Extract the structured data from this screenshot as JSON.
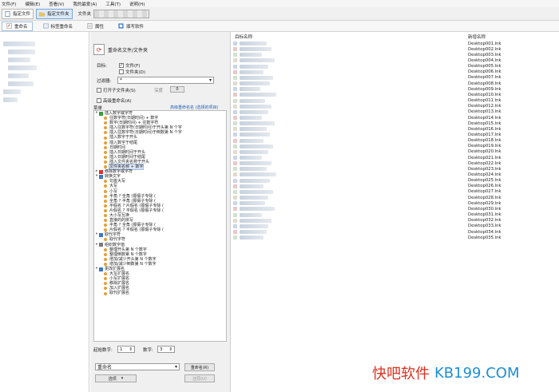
{
  "menu": [
    "文件(F)",
    "编辑(E)",
    "查看(V)",
    "我的最爱(A)",
    "工具(T)",
    "说明(H)"
  ],
  "toolbar": {
    "specify_file": "指定文件",
    "specify_folder": "指定文件夹",
    "folder_label": "文件夹"
  },
  "tabs": [
    "重命名",
    "标签重命名",
    "属性",
    "填写软件"
  ],
  "panel": {
    "title": "重命名文件/文件夹",
    "target_label": "目标:",
    "target_file": "文件(F)",
    "target_folder": "文件夹(D)",
    "filter_label": "过滤器:",
    "filter_value": "*",
    "include_subfolders": "打开子文件夹(S)",
    "depth_label": "深度",
    "depth_value": "0",
    "advanced": "高级重命名(A)",
    "menu_label": "菜单",
    "advanced_link": "高级重命名名 (选择的项目)",
    "start_label": "起始数字:",
    "start_value": "1",
    "digits_label": "数字:",
    "digits_value": "3",
    "action_select": "重命名",
    "rename_button": "重命名(R)",
    "options_button": "选项",
    "undo_button": "还原(U)"
  },
  "tree": [
    {
      "type": "cat",
      "text": "插入数字或字符",
      "expanded": true,
      "icon": "green"
    },
    {
      "type": "item",
      "text": "往数字符(日期时间) + 数字"
    },
    {
      "type": "item",
      "text": "数字(日期时间) + 往数字符"
    },
    {
      "type": "item",
      "text": "插入往数字符(日期时间)于开头第 N 个字"
    },
    {
      "type": "item",
      "text": "插入往数字符(日期时间)于倒数第 N 个字"
    },
    {
      "type": "item",
      "text": "插入数字于开头"
    },
    {
      "type": "item",
      "text": "插入数字于结尾"
    },
    {
      "type": "item",
      "text": "日期时间"
    },
    {
      "type": "item",
      "text": "插入日期时间于开头"
    },
    {
      "type": "item",
      "text": "插入日期时间于结尾"
    },
    {
      "type": "item",
      "text": "插入文件夹名称于开头"
    },
    {
      "type": "item",
      "text": "文件夹名称 + 数字",
      "selected": true
    },
    {
      "type": "cat",
      "text": "移除数字或字符",
      "expanded": false,
      "icon": "red"
    },
    {
      "type": "cat",
      "text": "转换文字",
      "expanded": true,
      "icon": "blue"
    },
    {
      "type": "item",
      "text": "句首大写"
    },
    {
      "type": "item",
      "text": "大写"
    },
    {
      "type": "item",
      "text": "小写"
    },
    {
      "type": "item",
      "text": "半角 ? 全角 (振假子专除 ( "
    },
    {
      "type": "item",
      "text": "全角 ? 半角 (振假子专除 ( "
    },
    {
      "type": "item",
      "text": "平假名 ? 片假名 (振假子专除 ( "
    },
    {
      "type": "item",
      "text": "片假名 ? 平假名 (振假子专除 ( "
    },
    {
      "type": "item",
      "text": "大小写互换"
    },
    {
      "type": "item",
      "text": "直接的的拼写"
    },
    {
      "type": "item",
      "text": "半角 ? 全角 (振假子专除 ( "
    },
    {
      "type": "item",
      "text": "片假名 ? 平假名 (振假子专除 ( "
    },
    {
      "type": "cat",
      "text": "取代字符",
      "expanded": true,
      "icon": "blue"
    },
    {
      "type": "item",
      "text": "取代字符"
    },
    {
      "type": "cat",
      "text": "组织数字值",
      "expanded": true,
      "icon": "gray"
    },
    {
      "type": "item",
      "text": "整理开头第 N 个数字"
    },
    {
      "type": "item",
      "text": "整理倒数第 N 个数字"
    },
    {
      "type": "item",
      "text": "增加/减少开头第 N 个数字"
    },
    {
      "type": "item",
      "text": "增加/减少倒数第 N 个数字"
    },
    {
      "type": "cat",
      "text": "更改扩展名",
      "expanded": true,
      "icon": "blue"
    },
    {
      "type": "item",
      "text": "大写扩展名"
    },
    {
      "type": "item",
      "text": "小写扩展名"
    },
    {
      "type": "item",
      "text": "移除扩展名"
    },
    {
      "type": "item",
      "text": "加入扩展名"
    },
    {
      "type": "item",
      "text": "取代扩展名"
    }
  ],
  "file_list": {
    "col_target": "目标名称",
    "col_newname": "新增名称",
    "rows": [
      "Desktop001.lnk",
      "Desktop002.lnk",
      "Desktop003.lnk",
      "Desktop004.lnk",
      "Desktop005.lnk",
      "Desktop006.lnk",
      "Desktop007.lnk",
      "Desktop008.lnk",
      "Desktop009.lnk",
      "Desktop010.lnk",
      "Desktop011.lnk",
      "Desktop012.lnk",
      "Desktop013.lnk",
      "Desktop014.lnk",
      "Desktop015.lnk",
      "Desktop016.lnk",
      "Desktop017.lnk",
      "Desktop018.lnk",
      "Desktop019.lnk",
      "Desktop020.lnk",
      "Desktop021.lnk",
      "Desktop022.lnk",
      "Desktop023.lnk",
      "Desktop024.lnk",
      "Desktop025.lnk",
      "Desktop026.lnk",
      "Desktop027.lnk",
      "Desktop028.lnk",
      "Desktop029.lnk",
      "Desktop030.lnk",
      "Desktop031.lnk",
      "Desktop032.lnk",
      "Desktop033.lnk",
      "Desktop034.lnk",
      "Desktop035.lnk"
    ]
  },
  "watermark": {
    "cn": "快吧软件",
    "en": "KB199.COM"
  },
  "colors": {
    "accent": "#1d8ed6",
    "watermark_red": "#e0301e",
    "selection": "#dde8f6"
  }
}
